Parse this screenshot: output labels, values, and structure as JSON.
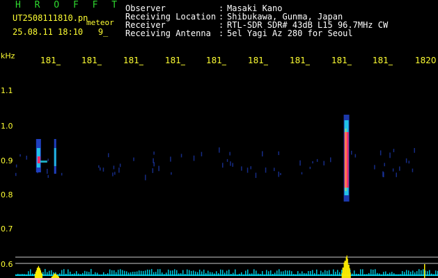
{
  "header": {
    "app_title": "H R O F F T",
    "filename": "UT2508111810.pn",
    "meteor_label": "meteor",
    "datetime": "25.08.11 18:10   9_",
    "meta": [
      {
        "label": "Observer",
        "value": "Masaki Kano"
      },
      {
        "label": "Receiving Location",
        "value": "Shibukawa, Gunma, Japan"
      },
      {
        "label": "Receiver",
        "value": "RTL-SDR SDR# 43dB L15 96.7MHz CW"
      },
      {
        "label": "Receiving Antenna",
        "value": "5el Yagi Az 280 for Seoul"
      }
    ],
    "colon": ":"
  },
  "time_axis": {
    "unit_label": "kHz",
    "ticks": [
      "181_",
      "181_",
      "181_",
      "181_",
      "181_",
      "181_",
      "181_",
      "181_",
      "181_",
      "1820"
    ]
  },
  "freq_axis": {
    "ticks": [
      "1.1",
      "1.0",
      "0.9",
      "0.8",
      "0.7",
      "0.6"
    ]
  },
  "colors": {
    "text": "#ffffff",
    "label": "#ffff33",
    "title": "#2fd82f",
    "noise": "#1f3fbf",
    "echo_core": "#ff2a6a",
    "echo_mid": "#22d3ee",
    "echo_edge": "#eaea3a",
    "activity_bar": "#ffee00",
    "baseline": "#00e5ff"
  },
  "echoes": [
    {
      "minute": 0.55,
      "kind": "medium"
    },
    {
      "minute": 0.95,
      "kind": "small"
    },
    {
      "minute": 7.95,
      "kind": "large"
    }
  ]
}
